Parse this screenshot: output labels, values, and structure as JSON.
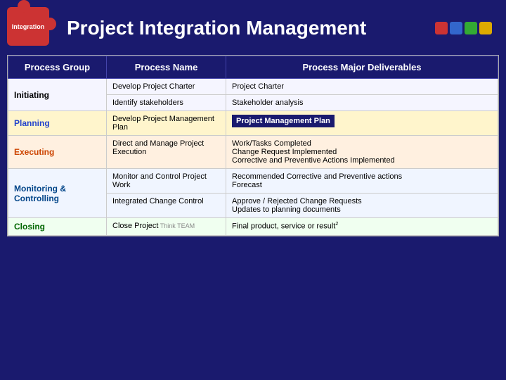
{
  "page": {
    "title": "Project Integration Management",
    "integration_label": "Integration"
  },
  "table": {
    "headers": [
      "Process Group",
      "Process Name",
      "Process Major Deliverables"
    ],
    "rows": [
      {
        "group": "Initiating",
        "group_rowspan": 2,
        "process": "Develop Project Charter",
        "deliverables": [
          "Project Charter"
        ],
        "deliverable_bold": false
      },
      {
        "group": "",
        "process": "Identify stakeholders",
        "deliverables": [
          "Stakeholder analysis"
        ],
        "deliverable_bold": false
      },
      {
        "group": "Planning",
        "group_rowspan": 1,
        "process": "Develop Project Management Plan",
        "deliverables": [
          "Project Management Plan"
        ],
        "deliverable_bold": true
      },
      {
        "group": "Executing",
        "group_rowspan": 1,
        "process": "Direct and Manage Project Execution",
        "deliverables": [
          "Work/Tasks Completed",
          "Change Request Implemented",
          "Corrective and Preventive Actions Implemented"
        ],
        "deliverable_bold": false
      },
      {
        "group": "Monitoring & Controlling",
        "group_rowspan": 2,
        "process": "Monitor and Control Project Work",
        "deliverables": [
          "Recommended Corrective and Preventive actions",
          "Forecast"
        ],
        "deliverable_bold": false
      },
      {
        "group": "",
        "process": "Integrated Change Control",
        "deliverables": [
          "Approve / Rejected Change Requests",
          "Updates to planning documents"
        ],
        "deliverable_bold": false
      },
      {
        "group": "Closing",
        "group_rowspan": 1,
        "process": "Close Project",
        "deliverables": [
          "Final product, service or result"
        ],
        "deliverable_bold": false
      }
    ]
  }
}
